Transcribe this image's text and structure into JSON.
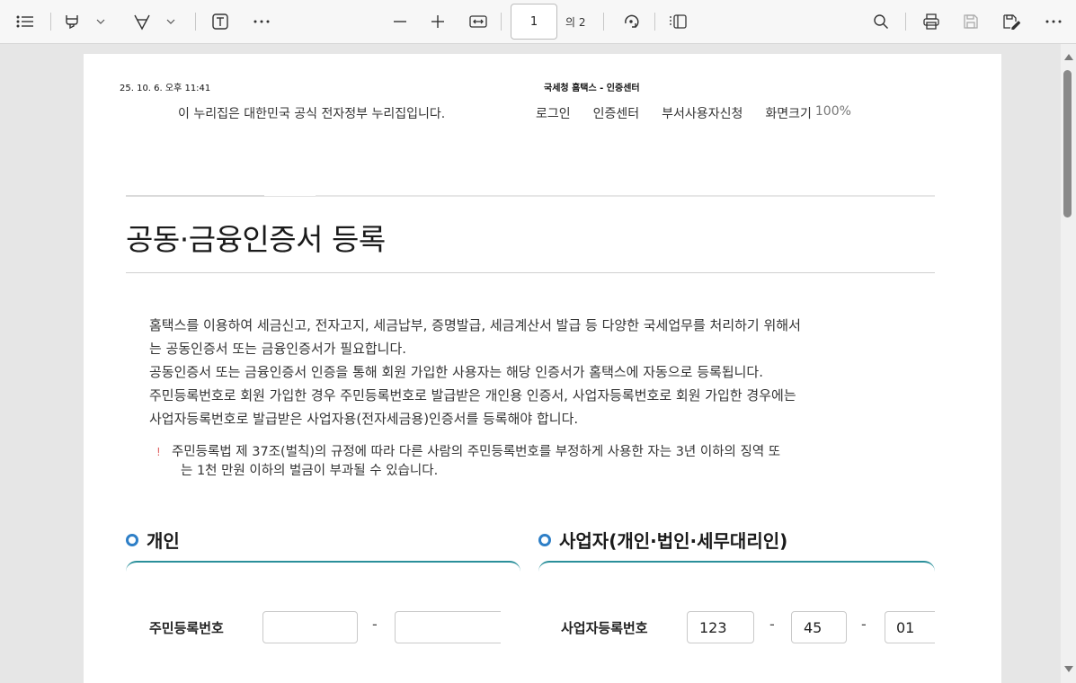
{
  "toolbar": {
    "page_current": "1",
    "page_of": "의 2"
  },
  "page": {
    "header_date": "25. 10. 6. 오후 11:41",
    "header_site": "국세청 홈택스 - 인증센터",
    "gov_note": "이 누리집은 대한민국 공식 전자정부 누리집입니다.",
    "nav": {
      "login": "로그인",
      "auth_center": "인증센터",
      "dept_user": "부서사용자신청",
      "screen_size": "화면크기",
      "zoom": "100%"
    },
    "title": "공동·금융인증서 등록",
    "desc": [
      "홈택스를 이용하여 세금신고, 전자고지, 세금납부, 증명발급, 세금계산서 발급 등 다양한 국세업무를 처리하기 위해서",
      "는 공동인증서 또는 금융인증서가 필요합니다.",
      "공동인증서 또는 금융인증서 인증을 통해 회원 가입한 사용자는 해당 인증서가 홈택스에 자동으로 등록됩니다.",
      "주민등록번호로 회원 가입한 경우 주민등록번호로 발급받은 개인용 인증서, 사업자등록번호로 회원 가입한 경우에는",
      "사업자등록번호로 발급받은 사업자용(전자세금용)인증서를 등록해야 합니다."
    ],
    "warning_mark": "!",
    "warning": [
      "주민등록법 제 37조(벌칙)의 규정에 따라 다른 사람의 주민등록번호를 부정하게 사용한 자는 3년 이하의 징역 또",
      "는 1천 만원 이하의 벌금이 부과될 수 있습니다."
    ],
    "individual": {
      "heading": "개인",
      "field_label": "주민등록번호",
      "part1": "",
      "dash": "-",
      "part2": ""
    },
    "business": {
      "heading": "사업자(개인·법인·세무대리인)",
      "field_label": "사업자등록번호",
      "part1": "123",
      "dash1": "-",
      "part2": "45",
      "dash2": "-",
      "part3": "01"
    }
  },
  "colors": {
    "accent_blue": "#2e7fc7",
    "section_line_teal": "#2a8f9a",
    "warning_red": "#e06666"
  }
}
